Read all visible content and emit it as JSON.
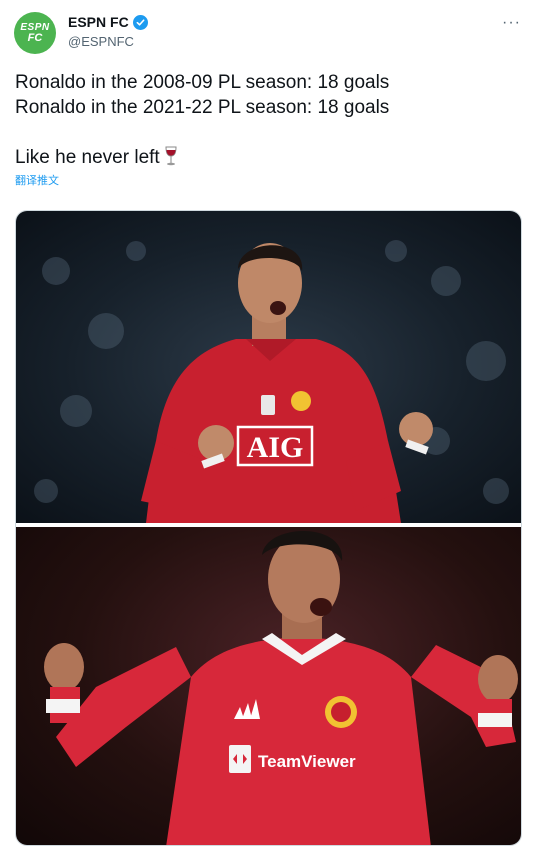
{
  "author": {
    "avatar_text_line1": "ESPN",
    "avatar_text_line2": "FC",
    "display_name": "ESPN FC",
    "handle": "@ESPNFC",
    "verified": true,
    "avatar_color": "#4cb450",
    "verified_color": "#1d9bf0"
  },
  "more_icon": "more-horizontal-icon",
  "tweet": {
    "line1": "Ronaldo in the 2008-09 PL season: 18 goals",
    "line2": "Ronaldo in the 2021-22 PL season: 18 goals",
    "line3": "Like he never left",
    "emoji": "wine-glass-icon"
  },
  "translate_label": "翻译推文",
  "media": {
    "photo_top": {
      "shirt_sponsor": "AIG"
    },
    "photo_bottom": {
      "shirt_sponsor": "TeamViewer"
    }
  }
}
